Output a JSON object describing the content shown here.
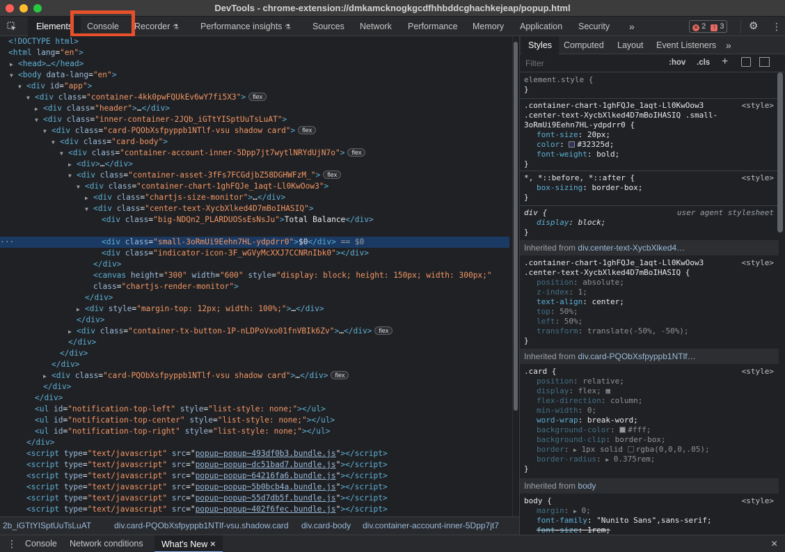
{
  "window": {
    "title": "DevTools - chrome-extension://dmkamcknogkgcdfhhbddcghachkejeap/popup.html"
  },
  "colors": {
    "close": "#ff5f57",
    "minimize": "#febc2e",
    "maximize": "#28c840",
    "accent_highlight": "#e8502c"
  },
  "tabs": [
    {
      "label": "Elements"
    },
    {
      "label": "Console"
    },
    {
      "label": "Recorder"
    },
    {
      "label": "Performance insights"
    },
    {
      "label": "Sources"
    },
    {
      "label": "Network"
    },
    {
      "label": "Performance"
    },
    {
      "label": "Memory"
    },
    {
      "label": "Application"
    },
    {
      "label": "Security"
    }
  ],
  "toolbar": {
    "more_tabs": "»",
    "errors_count": "2",
    "warnings_count": "3"
  },
  "styles_tabs": [
    {
      "label": "Styles"
    },
    {
      "label": "Computed"
    },
    {
      "label": "Layout"
    },
    {
      "label": "Event Listeners"
    }
  ],
  "styles_more": "»",
  "filter": {
    "placeholder": "Filter",
    "hov": ":hov",
    "cls": ".cls",
    "plus": "+"
  },
  "breadcrumb": [
    "2b_iGTtYISptUuTsLuAT",
    "div.card-PQObXsfpyppb1NTlf-vsu.shadow.card",
    "div.card-body",
    "div.container-account-inner-5Dpp7jt7"
  ],
  "drawer": {
    "tabs": [
      "Console",
      "Network conditions",
      "What's New"
    ],
    "close_tab": "×",
    "close_drawer": "×"
  },
  "dom": {
    "l1": "<!DOCTYPE html>",
    "html_open": "<html",
    "lang": "lang",
    "lang_val": "\"en\"",
    "head": "<head>…</head>",
    "body_open": "<body",
    "data_lang": "data-lang",
    "id": "id",
    "cls": "class",
    "app_val": "\"app\"",
    "c1": "\"container-4kk0pwFQUkEv6wY7fi5X3\"",
    "c2": "\"header\"",
    "c3": "\"inner-container-2JQb_iGTtYISptUuTsLuAT\"",
    "c4": "\"card-PQObXsfpyppb1NTlf-vsu shadow card\"",
    "c5": "\"card-body\"",
    "c6": "\"container-account-inner-5Dpp7jt7wytlNRYdUjN7o\"",
    "c7": "\"container-asset-3fFs7FCGdjbZ58DGHWFzM_\"",
    "c8": "\"container-chart-1ghFQJe_1aqt-Ll0KwOow3\"",
    "c9": "\"chartjs-size-monitor\"",
    "c10": "\"center-text-XycbXlked4D7mBoIHASIQ\"",
    "c11": "\"big-NDQn2_PLARDUOSsEsNsJu\"",
    "total_balance": "Total Balance",
    "c12": "\"small-3oRmUi9Eehn7HL-ydpdrr0\"",
    "dollar0": "$0",
    "eq0": " == $0",
    "c13": "\"indicator-icon-3F_wGVyMcXXJ7CCNRnIbk0\"",
    "canvas_height": "height",
    "canvas_height_val": "\"300\"",
    "canvas_width": "width",
    "canvas_width_val": "\"600\"",
    "style": "style",
    "canvas_style": "\"display: block; height: 150px; width: 300px;\"",
    "canvas_class": "\"chartjs-render-monitor\"",
    "mt_style": "\"margin-top: 12px; width: 100%;\"",
    "c14": "\"container-tx-button-1P-nLDPoVxo01fnVBIk6Zv\"",
    "ul1": "\"notification-top-left\"",
    "ul2": "\"notification-top-center\"",
    "ul3": "\"notification-top-right\"",
    "ul_style": "\"list-style: none;\"",
    "type": "type",
    "type_val": "\"text/javascript\"",
    "src": "src",
    "scripts": [
      "popup~popup~493df0b3.bundle.js",
      "popup~popup~dc51bad7.bundle.js",
      "popup~popup~64216fa6.bundle.js",
      "popup~popup~5b0bcb4a.bundle.js",
      "popup~popup~55d7db5f.bundle.js",
      "popup~popup~402f6fec.bundle.js"
    ],
    "flex": "flex",
    "dots": "…"
  },
  "styles": {
    "element_style": "element.style {",
    "close": "}",
    "r1_sel1": ".container-chart-1ghFQJe_1aqt-Ll0KwOow3",
    "r1_sel2": ".center-text-XycbXlked4D7mBoIHASIQ .small-",
    "r1_sel3": "3oRmUi9Eehn7HL-ydpdrr0 {",
    "src_style": "<style>",
    "font_size": "font-size",
    "font_size_val": "20px;",
    "color": "color",
    "color_val": "#32325d;",
    "color_hex": "#32325d",
    "font_weight": "font-weight",
    "font_weight_val": "bold;",
    "r2_sel": "*, *::before, *::after {",
    "box_sizing": "box-sizing",
    "box_sizing_val": "border-box;",
    "r3_sel": "div {",
    "ua": "user agent stylesheet",
    "display": "display",
    "display_block": "block;",
    "inh1_prefix": "Inherited from",
    "inh1_sel": "div.center-text-XycbXlked4…",
    "r4_sel1": ".container-chart-1ghFQJe_1aqt-Ll0KwOow3",
    "r4_sel2": ".center-text-XycbXlked4D7mBoIHASIQ {",
    "position": "position",
    "absolute": "absolute;",
    "zindex": "z-index",
    "zindex_val": "1;",
    "text_align": "text-align",
    "center": "center;",
    "top": "top",
    "p50": "50%;",
    "left": "left",
    "transform": "transform",
    "transform_val": "translate(-50%, -50%);",
    "inh2_sel": "div.card-PQObXsfpyppb1NTlf…",
    "card_sel": ".card {",
    "relative": "relative;",
    "flex_val": "flex;",
    "flex_dir": "flex-direction",
    "column": "column;",
    "min_width": "min-width",
    "zero": "0;",
    "word_wrap": "word-wrap",
    "break_word": "break-word;",
    "bg_color": "background-color",
    "fff": "#fff;",
    "bg_clip": "background-clip",
    "border_box": "border-box;",
    "border": "border",
    "border_val": "1px solid",
    "rgba": "rgba(0,0,0,.05);",
    "border_radius": "border-radius",
    "radius_val": "0.375rem;",
    "inh3_sel": "body",
    "body_sel": "body {",
    "margin": "margin",
    "font_family": "font-family",
    "font_family_val": "\"Nunito Sans\",sans-serif;",
    "font_size_rem": "1rem;"
  }
}
